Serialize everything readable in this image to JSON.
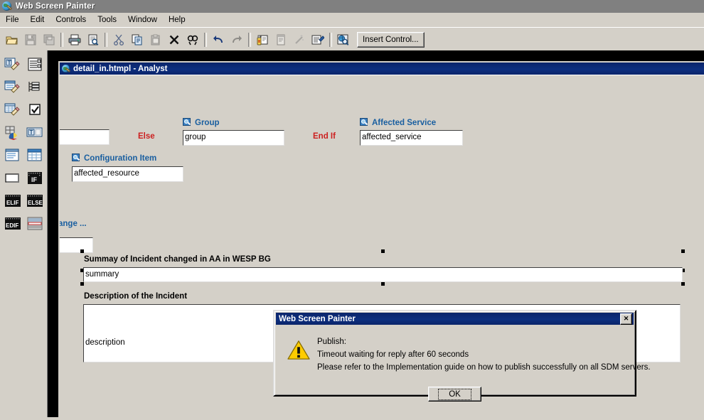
{
  "app": {
    "title": "Web Screen Painter",
    "icon": "globe-pencil-icon"
  },
  "menubar": {
    "items": [
      {
        "label": "File",
        "name": "menu-file"
      },
      {
        "label": "Edit",
        "name": "menu-edit"
      },
      {
        "label": "Controls",
        "name": "menu-controls"
      },
      {
        "label": "Tools",
        "name": "menu-tools"
      },
      {
        "label": "Window",
        "name": "menu-window"
      },
      {
        "label": "Help",
        "name": "menu-help"
      }
    ]
  },
  "toolbar": {
    "buttons": [
      {
        "name": "open-icon",
        "title": "Open",
        "disabled": false
      },
      {
        "name": "save-icon",
        "title": "Save",
        "disabled": true
      },
      {
        "name": "save-all-icon",
        "title": "Save All",
        "disabled": true
      },
      {
        "name": "print-icon",
        "title": "Print",
        "disabled": false
      },
      {
        "name": "print-preview-icon",
        "title": "Print Preview",
        "disabled": false
      },
      {
        "name": "cut-icon",
        "title": "Cut",
        "disabled": false
      },
      {
        "name": "copy-icon",
        "title": "Copy",
        "disabled": false
      },
      {
        "name": "paste-icon",
        "title": "Paste",
        "disabled": true
      },
      {
        "name": "delete-icon",
        "title": "Delete",
        "disabled": false
      },
      {
        "name": "find-icon",
        "title": "Find",
        "disabled": false
      },
      {
        "name": "undo-icon",
        "title": "Undo",
        "disabled": false
      },
      {
        "name": "redo-icon",
        "title": "Redo",
        "disabled": true
      },
      {
        "name": "publish-icon",
        "title": "Publish",
        "disabled": false
      },
      {
        "name": "properties-icon",
        "title": "Properties",
        "disabled": true
      },
      {
        "name": "magic-wand-icon",
        "title": "Wizard",
        "disabled": true
      },
      {
        "name": "edit-source-icon",
        "title": "Edit Source",
        "disabled": false
      },
      {
        "name": "preview-web-icon",
        "title": "Preview",
        "disabled": false
      }
    ],
    "insert_control_label": "Insert Control..."
  },
  "palette": {
    "buttons": [
      {
        "name": "text-field-tool-icon"
      },
      {
        "name": "dropdown-list-tool-icon"
      },
      {
        "name": "date-field-tool-icon"
      },
      {
        "name": "tree-list-tool-icon"
      },
      {
        "name": "table-field-tool-icon"
      },
      {
        "name": "checkbox-tool-icon"
      },
      {
        "name": "color-palette-tool-icon"
      },
      {
        "name": "label-tool-icon"
      },
      {
        "name": "list-box-tool-icon"
      },
      {
        "name": "grid-tool-icon"
      },
      {
        "name": "button-tool-icon"
      },
      {
        "name": "if-block-tool-icon"
      },
      {
        "name": "elif-block-tool-icon"
      },
      {
        "name": "else-block-tool-icon"
      },
      {
        "name": "endif-block-tool-icon"
      },
      {
        "name": "form-tool-icon"
      }
    ]
  },
  "child_window": {
    "title": "detail_in.htmpl - Analyst",
    "icon": "globe-pencil-icon"
  },
  "canvas": {
    "labels": [
      {
        "name": "label-else",
        "text": "Else",
        "kind": "red"
      },
      {
        "name": "label-group",
        "text": "Group",
        "kind": "blue"
      },
      {
        "name": "label-end-if",
        "text": "End If",
        "kind": "red"
      },
      {
        "name": "label-affected-service",
        "text": "Affected Service",
        "kind": "blue"
      },
      {
        "name": "label-configuration-item",
        "text": "Configuration Item",
        "kind": "blue"
      },
      {
        "name": "label-change-truncated",
        "text": "ange ...",
        "kind": "blue"
      },
      {
        "name": "label-summary-heading",
        "text": "Summay of Incident changed in AA in WESP BG",
        "kind": "black"
      },
      {
        "name": "label-description-heading",
        "text": "Description of the Incident",
        "kind": "black"
      }
    ],
    "fields": [
      {
        "name": "field-unnamed-left",
        "value": ""
      },
      {
        "name": "field-group",
        "value": "group"
      },
      {
        "name": "field-affected-service",
        "value": "affected_service"
      },
      {
        "name": "field-configuration-item",
        "value": "affected_resource"
      },
      {
        "name": "field-change-truncated",
        "value": ""
      },
      {
        "name": "field-summary",
        "value": "summary"
      },
      {
        "name": "field-description",
        "value": "description"
      }
    ]
  },
  "dialog": {
    "title": "Web Screen Painter",
    "close_label": "✕",
    "icon": "warning-triangle-icon",
    "lines": [
      "Publish:",
      "Timeout waiting for reply after 60 seconds",
      "Please refer to the Implementation guide on how to publish successfully on all SDM servers."
    ],
    "ok_label": "OK"
  },
  "colors": {
    "window_face": "#d4d0c8",
    "title_active": "#0a246a",
    "title_inactive": "#808080",
    "label_blue": "#1a5fa0",
    "label_red": "#cc2020",
    "mdi_background": "#000000",
    "warning_yellow": "#ffcc00"
  }
}
